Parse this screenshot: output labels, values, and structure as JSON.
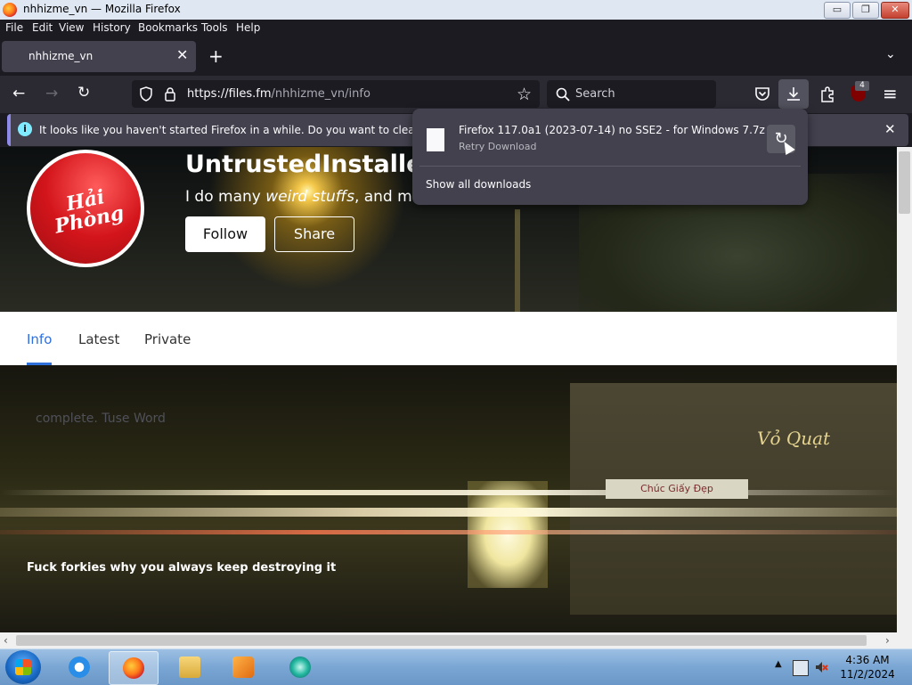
{
  "window": {
    "title": "nhhizme_vn — Mozilla Firefox",
    "minimize_glyph": "▭",
    "restore_glyph": "❐",
    "close_glyph": "✕"
  },
  "menubar": {
    "items": [
      "File",
      "Edit",
      "View",
      "History",
      "Bookmarks",
      "Tools",
      "Help"
    ]
  },
  "tabs": {
    "items": [
      {
        "label": "nhhizme_vn",
        "close": "✕"
      }
    ],
    "new_tab": "+",
    "list_all": "⌄"
  },
  "navbar": {
    "back": "←",
    "forward": "→",
    "reload": "↻",
    "url_host": "https://files.fm",
    "url_path": "/nhhizme_vn/info",
    "star": "☆",
    "search_placeholder": "Search",
    "menu": "≡",
    "ublock_badge": "4"
  },
  "notification": {
    "info_glyph": "i",
    "message": "It looks like you haven't started Firefox in a while. Do you want to clean it up for",
    "close": "✕"
  },
  "downloads_panel": {
    "file_name": "Firefox 117.0a1 (2023-07-14) no SSE2 - for Windows 7.7z",
    "status": "Retry Download",
    "retry_glyph": "↻",
    "show_all": "Show all downloads"
  },
  "profile": {
    "name": "UntrustedInstaller'",
    "bio_prefix": "I do many ",
    "bio_italic": "weird stuffs",
    "bio_suffix": ", and mo",
    "avatar_text": "Hải Phòng",
    "follow": "Follow",
    "share": "Share"
  },
  "profile_tabs": {
    "items": [
      "Info",
      "Latest",
      "Private"
    ],
    "active": "Info"
  },
  "banner": {
    "ghost_text": "complete. Tuse Word",
    "sign_text": "Vỏ Quạt",
    "sign2_text": "Chúc Giấy Đẹp",
    "caption": "Fuck forkies why you always keep destroying it"
  },
  "scrollbar": {
    "left_arrow": "‹",
    "right_arrow": "›"
  },
  "taskbar": {
    "time": "4:36 AM",
    "date": "11/2/2024",
    "tray_up": "▲"
  },
  "colors": {
    "accent_blue": "#2f6fdc",
    "firefox_dark": "#1c1b22",
    "firefox_toolbar": "#2b2a33",
    "panel": "#42414d",
    "info_cyan": "#80ebff"
  }
}
